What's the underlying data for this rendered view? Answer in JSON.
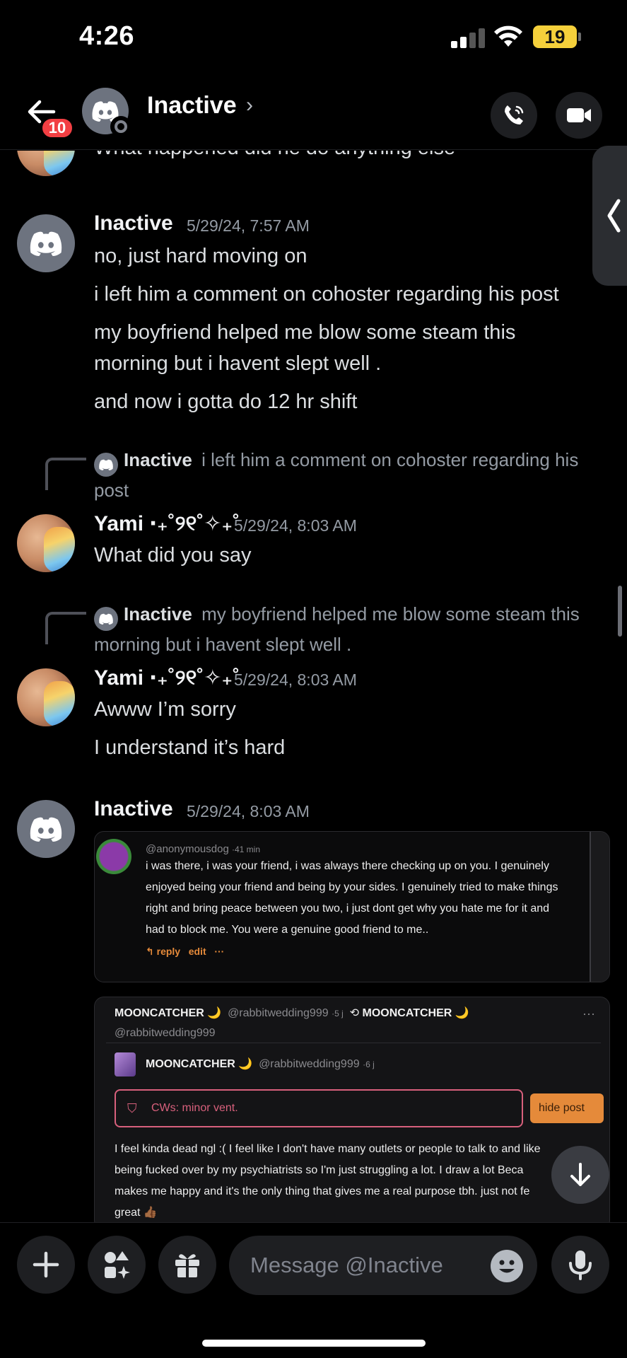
{
  "status_bar": {
    "time": "4:26",
    "battery": "19"
  },
  "header": {
    "unread_count": "10",
    "title": "Inactive",
    "chevron": "›"
  },
  "messages": {
    "m0": {
      "text": "What happened did he do anything else"
    },
    "m1": {
      "author": "Inactive",
      "time": "5/29/24, 7:57 AM",
      "lines": [
        "no, just hard moving on",
        "i left him a comment on cohoster regarding his post",
        "my boyfriend helped me blow some steam this",
        "morning but i havent slept well .",
        "and now i gotta do 12 hr shift"
      ]
    },
    "m2": {
      "reply_author": "Inactive",
      "reply_text_a": "i left him a comment on cohoster regarding his",
      "reply_text_b": "post",
      "author": "Yami ‧₊˚୨୧˚✧₊˚",
      "time": "5/29/24, 8:03 AM",
      "lines": [
        "What did you say"
      ]
    },
    "m3": {
      "reply_author": "Inactive",
      "reply_text_a": "my boyfriend helped me blow some steam this",
      "reply_text_b": "morning but i havent slept well .",
      "author": "Yami ‧₊˚୨୧˚✧₊˚",
      "time": "5/29/24, 8:03 AM",
      "lines": [
        "Awww I’m sorry",
        "I understand it’s hard"
      ]
    },
    "m4": {
      "author": "Inactive",
      "time": "5/29/24, 8:03 AM"
    }
  },
  "embed1": {
    "handle": "@anonymousdog",
    "age": "·41 min",
    "lines": [
      "i was there, i was your friend, i was always there checking up on you. I genuinely",
      "enjoyed being your friend and being by your sides. I genuinely tried to make things",
      "right and bring peace between you two, i just dont get why you hate me for it and",
      "had to block me. You were a genuine good friend to me.."
    ],
    "reply": "reply",
    "edit": "edit",
    "more": "···"
  },
  "embed2": {
    "name": "MOONCATCHER 🌙",
    "handle": "@rabbitwedding999",
    "age1": "·5 j",
    "age2": "·6 j",
    "cw": "CWs: minor vent.",
    "hide_post": "hide post",
    "more": "···",
    "lines": [
      "I feel kinda dead ngl :( I feel like I don't have many outlets or people to talk to and like",
      "being fucked over by my psychiatrists so I'm just struggling a lot. I draw a lot Beca",
      "makes me happy and it's the only thing that gives me a real purpose tbh. just not fe",
      "great 👍🏾"
    ]
  },
  "composer": {
    "placeholder": "Message @Inactive"
  },
  "colors": {
    "background": "#000000",
    "accent_red": "#f23f43",
    "battery": "#f5d03b",
    "cohost_orange": "#e58a3a",
    "cw_pink": "#d8607c"
  },
  "icons": [
    "back-arrow-icon",
    "discord-icon",
    "phone-icon",
    "video-camera-icon",
    "chevron-left-icon",
    "plus-icon",
    "apps-icon",
    "gift-icon",
    "emoji-icon",
    "microphone-icon",
    "arrow-down-icon"
  ]
}
